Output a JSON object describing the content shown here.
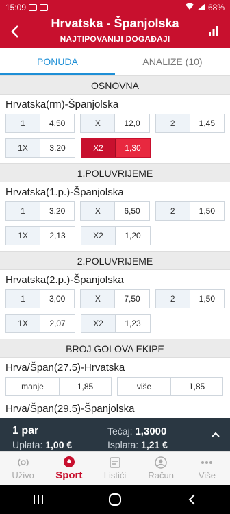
{
  "status": {
    "time": "15:09",
    "network": "VoLTE1",
    "battery": "68%"
  },
  "header": {
    "title": "Hrvatska - Španjolska",
    "subtitle": "NAJTIPOVANIJI DOGAĐAJI"
  },
  "tabs": [
    {
      "label": "PONUDA",
      "active": true
    },
    {
      "label": "ANALIZE (10)",
      "active": false
    }
  ],
  "sections": [
    {
      "title": "OSNOVNA",
      "market": "Hrvatska(rm)-Španjolska",
      "rows": [
        [
          {
            "label": "1",
            "value": "4,50"
          },
          {
            "label": "X",
            "value": "12,0"
          },
          {
            "label": "2",
            "value": "1,45"
          }
        ],
        [
          {
            "label": "1X",
            "value": "3,20"
          },
          {
            "label": "X2",
            "value": "1,30",
            "selected": true
          }
        ]
      ]
    },
    {
      "title": "1.POLUVRIJEME",
      "market": "Hrvatska(1.p.)-Španjolska",
      "rows": [
        [
          {
            "label": "1",
            "value": "3,20"
          },
          {
            "label": "X",
            "value": "6,50"
          },
          {
            "label": "2",
            "value": "1,50"
          }
        ],
        [
          {
            "label": "1X",
            "value": "2,13"
          },
          {
            "label": "X2",
            "value": "1,20"
          }
        ]
      ]
    },
    {
      "title": "2.POLUVRIJEME",
      "market": "Hrvatska(2.p.)-Španjolska",
      "rows": [
        [
          {
            "label": "1",
            "value": "3,00"
          },
          {
            "label": "X",
            "value": "7,50"
          },
          {
            "label": "2",
            "value": "1,50"
          }
        ],
        [
          {
            "label": "1X",
            "value": "2,07"
          },
          {
            "label": "X2",
            "value": "1,23"
          }
        ]
      ]
    },
    {
      "title": "BROJ GOLOVA EKIPE",
      "market": "Hrva/Špan(27.5)-Hrvatska",
      "rows": [
        [
          {
            "label": "manje",
            "value": "1,85"
          },
          {
            "label": "više",
            "value": "1,85"
          }
        ]
      ]
    }
  ],
  "partial_market": "Hrva/Špan(29.5)-Španjolska",
  "ticket": {
    "count": "1 par",
    "uplata_label": "Uplata:",
    "uplata": "1,00 €",
    "tecaj_label": "Tečaj:",
    "tecaj": "1,3000",
    "isplata_label": "Isplata:",
    "isplata": "1,21 €"
  },
  "nav": [
    {
      "label": "Uživo",
      "icon": "live-icon",
      "active": false
    },
    {
      "label": "Sport",
      "icon": "soccer-ball-icon",
      "active": true
    },
    {
      "label": "Listići",
      "icon": "tickets-icon",
      "active": false
    },
    {
      "label": "Račun",
      "icon": "account-icon",
      "active": false
    },
    {
      "label": "Više",
      "icon": "more-icon",
      "active": false
    }
  ],
  "colors": {
    "brand": "#c8102e",
    "tab_active": "#1e8fd6",
    "ticket_bg": "#2a3742"
  }
}
